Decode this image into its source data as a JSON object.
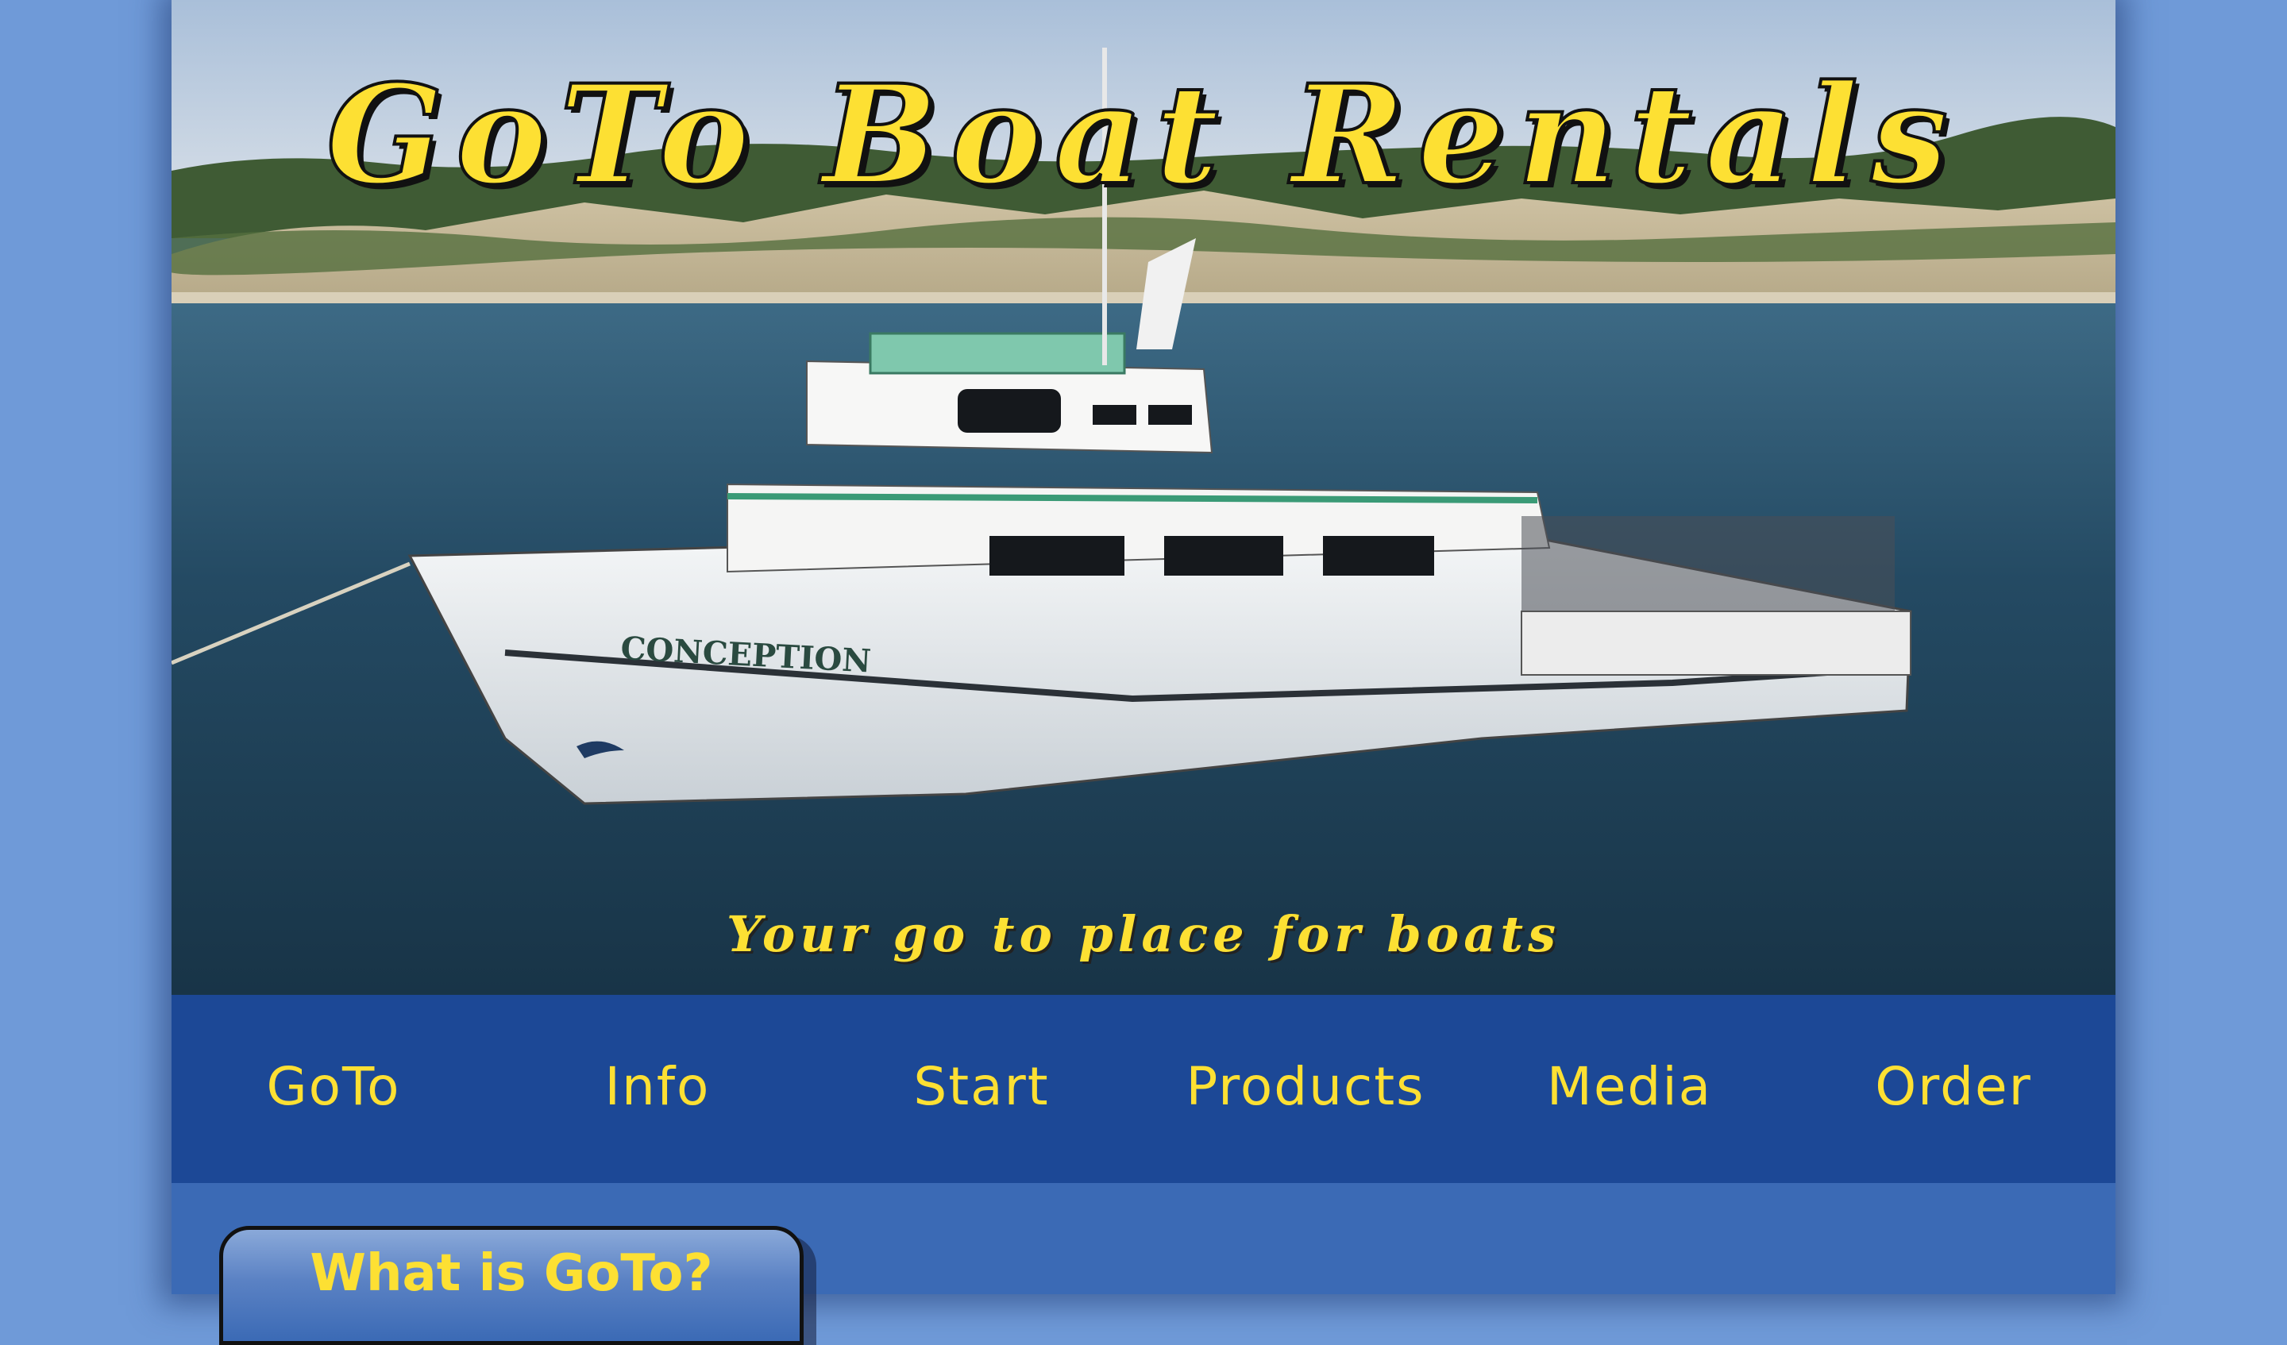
{
  "header": {
    "title": "GoTo Boat Rentals",
    "tagline": "Your go to place for boats",
    "boat_name": "CONCEPTION"
  },
  "nav": {
    "items": [
      {
        "label": "GoTo"
      },
      {
        "label": "Info"
      },
      {
        "label": "Start"
      },
      {
        "label": "Products"
      },
      {
        "label": "Media"
      },
      {
        "label": "Order"
      }
    ]
  },
  "main": {
    "section_heading": "What is GoTo?"
  },
  "colors": {
    "accent_yellow": "#fde033",
    "nav_blue": "#1c4896",
    "content_blue": "#3b6ab5",
    "page_background": "#6f9ad8"
  }
}
